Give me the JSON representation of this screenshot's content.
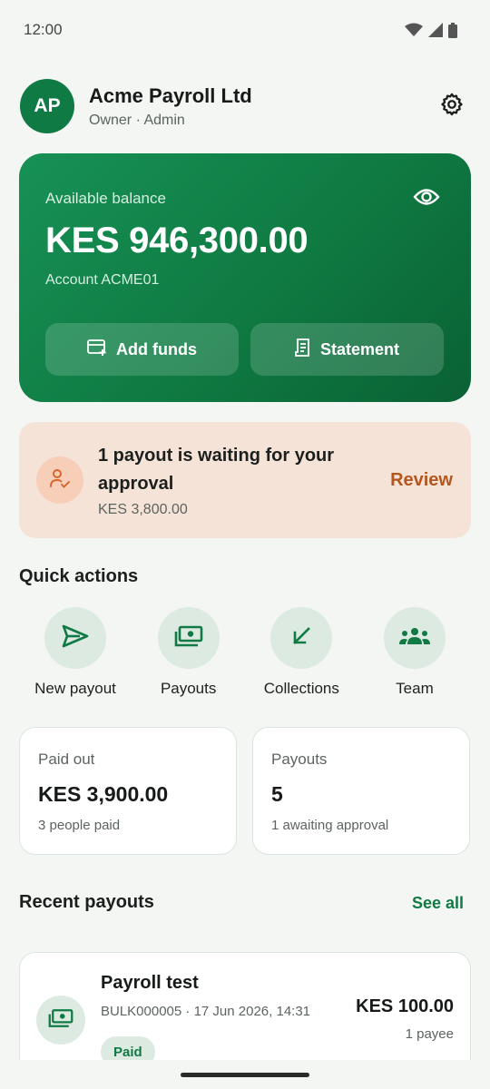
{
  "status_bar": {
    "time": "12:00"
  },
  "header": {
    "avatar_initials": "AP",
    "org_name": "Acme Payroll Ltd",
    "role": "Owner · Admin"
  },
  "balance": {
    "label": "Available balance",
    "amount": "KES 946,300.00",
    "account": "Account ACME01",
    "add_funds_label": "Add funds",
    "statement_label": "Statement"
  },
  "approval": {
    "title": "1 payout is waiting for your approval",
    "amount": "KES 3,800.00",
    "review_label": "Review"
  },
  "quick_actions": {
    "title": "Quick actions",
    "items": [
      {
        "label": "New payout",
        "icon": "send-icon"
      },
      {
        "label": "Payouts",
        "icon": "cash-icon"
      },
      {
        "label": "Collections",
        "icon": "arrow-down-left-icon"
      },
      {
        "label": "Team",
        "icon": "team-icon"
      }
    ]
  },
  "stats": {
    "paid_out": {
      "label": "Paid out",
      "value": "KES 3,900.00",
      "sub": "3 people paid"
    },
    "payouts": {
      "label": "Payouts",
      "value": "5",
      "sub": "1 awaiting approval"
    }
  },
  "recent": {
    "title": "Recent payouts",
    "see_all": "See all",
    "items": [
      {
        "name": "Payroll test",
        "meta": "BULK000005 · 17 Jun 2026, 14:31",
        "status": "Paid",
        "amount": "KES 100.00",
        "payees": "1 payee"
      }
    ]
  },
  "colors": {
    "brand_green": "#107a44",
    "warning_orange": "#b4571e",
    "approval_bg": "#f6e3d8"
  }
}
